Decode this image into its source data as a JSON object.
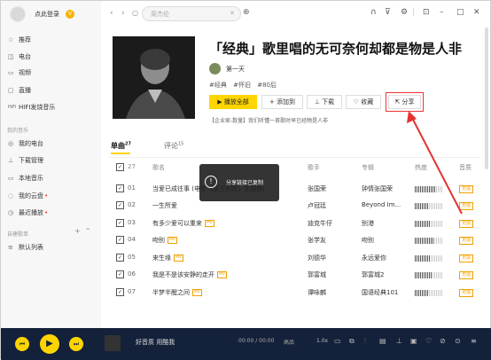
{
  "user": {
    "name": "点此登录",
    "vip": "V"
  },
  "sidebar": {
    "items": [
      {
        "icon": "☆",
        "label": "推荐"
      },
      {
        "icon": "◫",
        "label": "电台"
      },
      {
        "icon": "▭",
        "label": "视频"
      },
      {
        "icon": "▢",
        "label": "直播"
      },
      {
        "icon": "HiFi",
        "label": "HIFI发烧音乐"
      }
    ],
    "my_music_title": "我的音乐",
    "my_items": [
      {
        "icon": "◎",
        "label": "我的电台"
      },
      {
        "icon": "⊥",
        "label": "下载管理"
      },
      {
        "icon": "▭",
        "label": "本地音乐"
      },
      {
        "icon": "◌",
        "label": "我的云盘"
      },
      {
        "icon": "◷",
        "label": "最近播放"
      }
    ],
    "playlists_title": "自建歌单",
    "playlist_items": [
      {
        "icon": "≡",
        "label": "默认列表"
      }
    ]
  },
  "search": {
    "placeholder": "周杰伦"
  },
  "playlist": {
    "title": "「经典」歌里唱的无可奈何却都是物是人非",
    "creator": "第一天",
    "tags": [
      "#经典",
      "#怀旧",
      "#80后"
    ],
    "buttons": {
      "play": "播放全部",
      "add": "添加到",
      "download": "下载",
      "fav": "收藏",
      "share": "分享"
    },
    "desc": "【企业家-数量】我们听懂一首歌时早已经物是人非"
  },
  "tabs": {
    "songs": "单曲",
    "songs_count": "27",
    "comments": "评论",
    "comments_count": "15"
  },
  "table": {
    "headers": {
      "count": "27",
      "name": "歌名",
      "artist": "歌手",
      "album": "专辑",
      "heat": "热度",
      "quality": "音质"
    },
    "rows": [
      {
        "n": "01",
        "name": "当爱已成往事 (电影《霸王别姬》主题曲)",
        "mv": false,
        "artist": "张国荣",
        "album": "钟情张国荣",
        "heat": 0.75,
        "q": "无损"
      },
      {
        "n": "02",
        "name": "一生所爱",
        "mv": false,
        "artist": "卢冠廷",
        "album": "Beyond Im...",
        "heat": 0.5,
        "q": "无损"
      },
      {
        "n": "03",
        "name": "有多少爱可以重来",
        "mv": true,
        "artist": "迪克牛仔",
        "album": "别港",
        "heat": 0.55,
        "q": "无损"
      },
      {
        "n": "04",
        "name": "吻别",
        "mv": true,
        "artist": "张学友",
        "album": "吻别",
        "heat": 0.7,
        "q": "无损"
      },
      {
        "n": "05",
        "name": "来生缘",
        "mv": true,
        "artist": "刘德华",
        "album": "永远爱你",
        "heat": 0.55,
        "q": "无损"
      },
      {
        "n": "06",
        "name": "我是不是该安静的走开",
        "mv": true,
        "artist": "郭富城",
        "album": "郭富城2",
        "heat": 0.6,
        "q": "无损"
      },
      {
        "n": "07",
        "name": "半梦半醒之间",
        "mv": true,
        "artist": "谭咏麟",
        "album": "国语经典101",
        "heat": 0.5,
        "q": "无损"
      }
    ],
    "mv_label": "MV"
  },
  "toast": {
    "text": "分享链接已复制"
  },
  "player": {
    "song": "好音质 用酷我",
    "time": "00:00 / 00:00",
    "quality": "高品",
    "speed": "1.0x"
  },
  "colors": {
    "accent": "#ffd500",
    "annotation": "#e33333",
    "player_bg": "#14213a"
  }
}
